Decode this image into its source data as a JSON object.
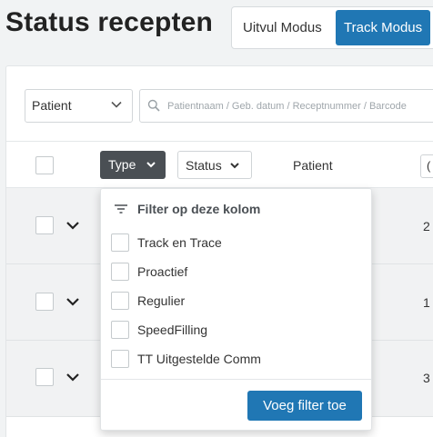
{
  "header": {
    "title": "Status recepten",
    "modes": [
      {
        "label": "Uitvul Modus",
        "active": false
      },
      {
        "label": "Track Modus",
        "active": true
      }
    ],
    "accent_color": "#2077b4"
  },
  "filters": {
    "select_value": "Patient",
    "search_placeholder": "Patientnaam / Geb. datum / Receptnummer / Barcode"
  },
  "table": {
    "columns": {
      "type": "Type",
      "status": "Status",
      "patient": "Patient",
      "next_partial": "("
    },
    "rows": [
      {
        "value_partial": "2"
      },
      {
        "value_partial": "1"
      },
      {
        "value_partial": "3"
      }
    ]
  },
  "type_filter_dropdown": {
    "heading": "Filter op deze kolom",
    "options": [
      {
        "label": "Track en Trace",
        "checked": false
      },
      {
        "label": "Proactief",
        "checked": false
      },
      {
        "label": "Regulier",
        "checked": false
      },
      {
        "label": "SpeedFilling",
        "checked": false
      },
      {
        "label": "TT Uitgestelde Comm",
        "checked": false
      }
    ],
    "apply_label": "Voeg filter toe"
  }
}
